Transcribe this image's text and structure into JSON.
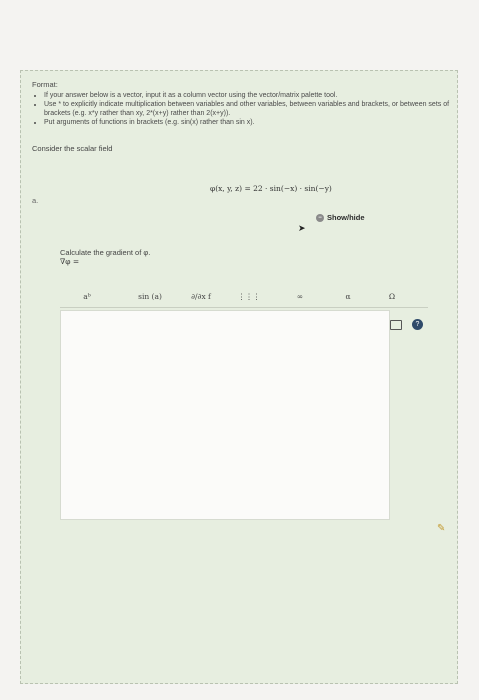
{
  "format": {
    "title": "Format:",
    "bullets": [
      "If your answer below is a vector, input it as a column vector using the vector/matrix palette tool.",
      "Use * to explicitly indicate multiplication between variables and other variables, between variables and brackets, or between sets of brackets (e.g. x*y rather than xy, 2*(x+y) rather than 2(x+y)).",
      "Put arguments of functions in brackets (e.g. sin(x) rather than sin x)."
    ]
  },
  "question": {
    "intro": "Consider the scalar field",
    "equation": "φ(x, y, z) = 22 · sin(−x) · sin(−y)",
    "part_label": "a.",
    "show_hide": "Show/hide",
    "instruction": "Calculate the gradient of φ.",
    "gradient_label": "∇φ ="
  },
  "palette": {
    "buttons": [
      {
        "label": "aᵇ"
      },
      {
        "label": "sin (a)"
      },
      {
        "label": "∂/∂x f"
      },
      {
        "label": "⋮⋮⋮"
      },
      {
        "label": "∞"
      },
      {
        "label": "α"
      },
      {
        "label": "Ω"
      }
    ]
  },
  "tools": {
    "keyboard_icon": "keyboard-icon",
    "help_icon": "help-icon",
    "help_label": "?"
  }
}
